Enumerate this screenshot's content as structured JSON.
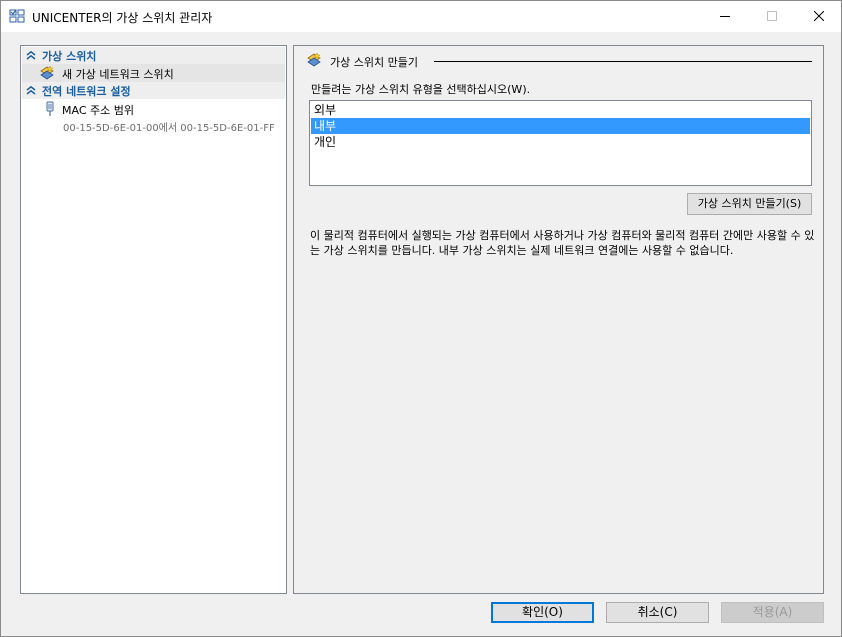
{
  "window": {
    "title": "UNICENTER의 가상 스위치 관리자"
  },
  "tree": {
    "sections": [
      {
        "label": "가상 스위치",
        "items": [
          {
            "label": "새 가상 네트워크 스위치",
            "icon": "virtual-switch-icon",
            "selected": true
          }
        ]
      },
      {
        "label": "전역 네트워크 설정",
        "items": [
          {
            "label": "MAC 주소 범위",
            "icon": "network-adapter-icon",
            "sub": "00-15-5D-6E-01-00에서 00-15-5D-6E-01-FF"
          }
        ]
      }
    ]
  },
  "main": {
    "section_title": "가상 스위치 만들기",
    "prompt": "만들려는 가상 스위치 유형을 선택하십시오(W).",
    "switch_types": [
      "외부",
      "내부",
      "개인"
    ],
    "selected_type": "내부",
    "create_button": "가상 스위치 만들기(S)",
    "description": "이 물리적 컴퓨터에서 실행되는 가상 컴퓨터에서 사용하거나 가상 컴퓨터와 물리적 컴퓨터 간에만 사용할 수 있는 가상 스위치를 만듭니다. 내부 가상 스위치는 실제 네트워크 연결에는 사용할 수 없습니다."
  },
  "footer": {
    "ok": "확인(O)",
    "cancel": "취소(C)",
    "apply": "적용(A)"
  },
  "colors": {
    "accent": "#0078d7",
    "section_header": "#1b5fa3",
    "selection": "#3399ff"
  }
}
